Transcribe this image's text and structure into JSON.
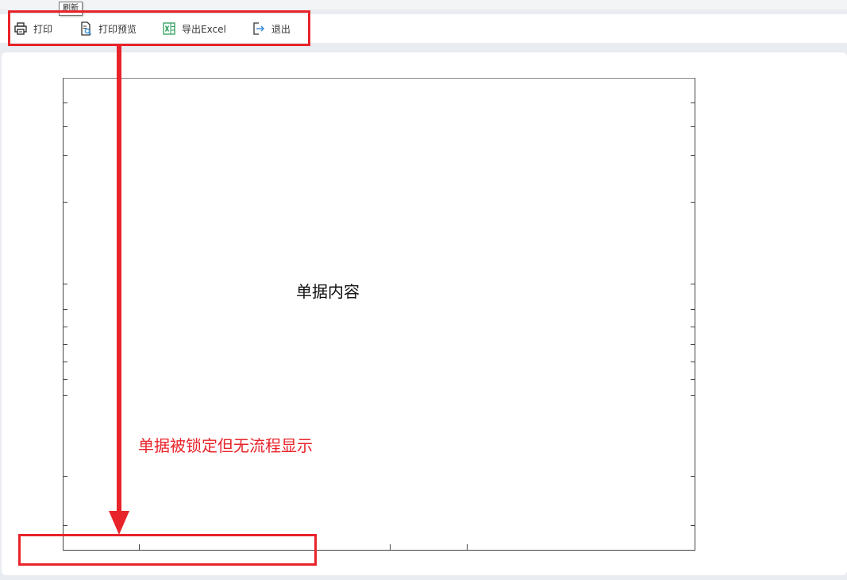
{
  "tooltip": "刷新",
  "toolbar": {
    "print_label": "打印",
    "preview_label": "打印预览",
    "export_label": "导出Excel",
    "exit_label": "退出"
  },
  "document": {
    "content_label": "单据内容"
  },
  "annotation": {
    "text": "单据被锁定但无流程显示"
  },
  "colors": {
    "highlight": "#e8232a",
    "excel_icon": "#2e9e5b",
    "preview_icon": "#3a8fd8",
    "exit_icon": "#3a8fd8"
  }
}
